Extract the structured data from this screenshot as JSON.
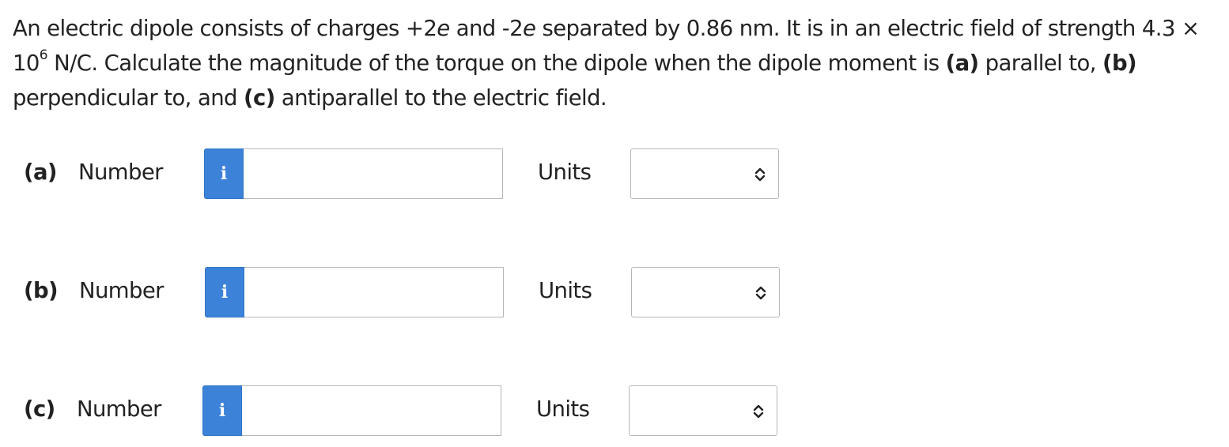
{
  "question": {
    "p1": "An electric dipole consists of charges +2",
    "e1": "e",
    "p2": " and -2",
    "e2": "e",
    "p3": " separated by 0.86 nm. It is in an electric field of strength 4.3 × 10",
    "exp": "6",
    "p4": " N/C. Calculate the magnitude of the torque on the dipole when the dipole moment is ",
    "a": "(a)",
    "p5": " parallel to, ",
    "b": "(b)",
    "p6": " perpendicular to, and ",
    "c": "(c)",
    "p7": " antiparallel to the electric field."
  },
  "parts": [
    {
      "label": "(a)",
      "number_label": "Number",
      "info_icon": "i",
      "number_value": "",
      "units_label": "Units",
      "units_value": ""
    },
    {
      "label": "(b)",
      "number_label": "Number",
      "info_icon": "i",
      "number_value": "",
      "units_label": "Units",
      "units_value": ""
    },
    {
      "label": "(c)",
      "number_label": "Number",
      "info_icon": "i",
      "number_value": "",
      "units_label": "Units",
      "units_value": ""
    }
  ],
  "colors": {
    "info_button": "#3b82d8",
    "text": "#222222",
    "border": "#b7b7b7"
  },
  "icons": {
    "info": "info-icon",
    "select": "chevron-up-down-icon"
  }
}
